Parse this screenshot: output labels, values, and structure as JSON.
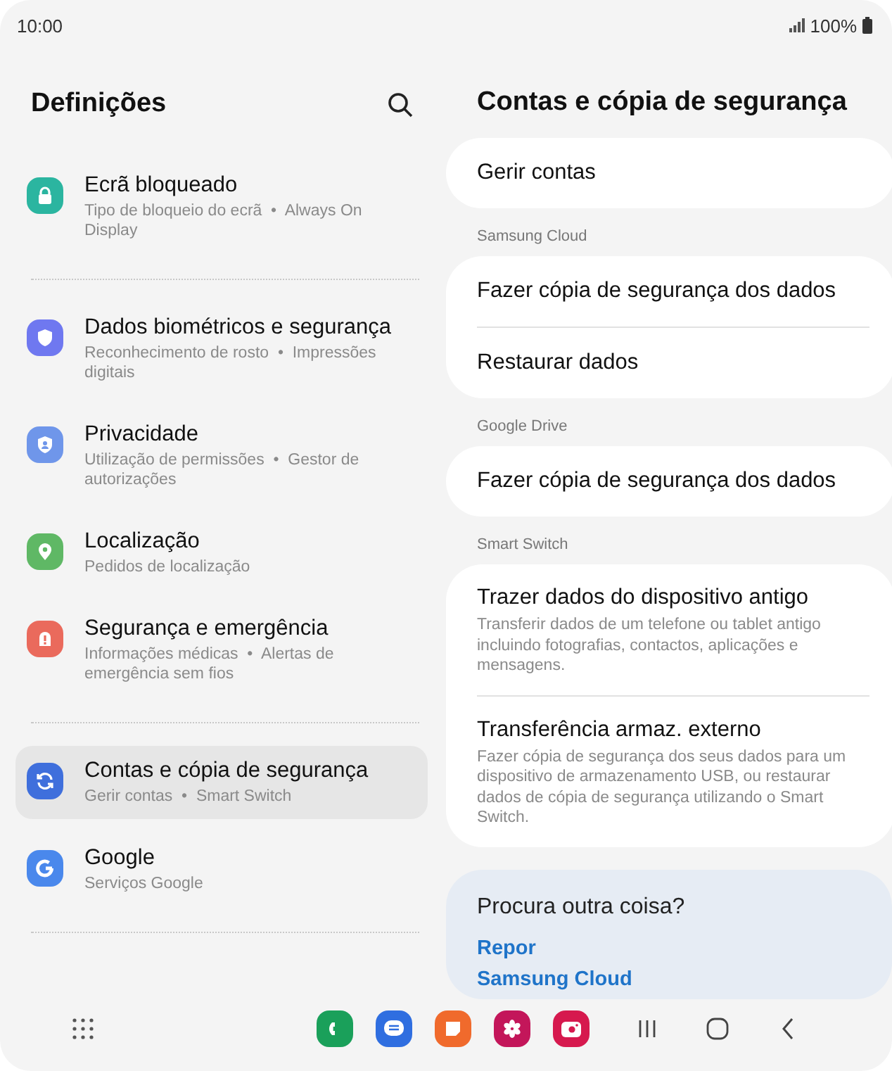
{
  "status_bar": {
    "time": "10:00",
    "battery": "100%"
  },
  "settings": {
    "title": "Definições",
    "groups": [
      {
        "items": [
          {
            "kind": "lock",
            "color": "#2bb5a0",
            "title": "Ecrã bloqueado",
            "subtitle": "Tipo de bloqueio do ecrã  •  Always On Display",
            "selected": false
          }
        ]
      },
      {
        "items": [
          {
            "kind": "shield",
            "color": "#6f78f0",
            "title": "Dados biométricos e segurança",
            "subtitle": "Reconhecimento de rosto  •  Impressões digitais",
            "selected": false
          },
          {
            "kind": "privacy",
            "color": "#6f96ea",
            "title": "Privacidade",
            "subtitle": "Utilização de permissões  •  Gestor de autorizações",
            "selected": false
          },
          {
            "kind": "location",
            "color": "#5fb865",
            "title": "Localização",
            "subtitle": "Pedidos de localização",
            "selected": false
          },
          {
            "kind": "alert",
            "color": "#ea6a5c",
            "title": "Segurança e emergência",
            "subtitle": "Informações médicas  •  Alertas de emergência sem fios",
            "selected": false
          }
        ]
      },
      {
        "items": [
          {
            "kind": "sync",
            "color": "#3f6fdc",
            "title": "Contas e cópia de segurança",
            "subtitle": "Gerir contas  •  Smart Switch",
            "selected": true
          },
          {
            "kind": "google",
            "color": "#4a88ec",
            "title": "Google",
            "subtitle": "Serviços Google",
            "selected": false
          }
        ]
      }
    ]
  },
  "detail": {
    "title": "Contas e cópia de segurança",
    "sections": [
      {
        "items": [
          {
            "title": "Gerir contas"
          }
        ]
      },
      {
        "header": "Samsung Cloud",
        "items": [
          {
            "title": "Fazer cópia de segurança dos dados"
          },
          {
            "title": "Restaurar dados"
          }
        ]
      },
      {
        "header": "Google Drive",
        "items": [
          {
            "title": "Fazer cópia de segurança dos dados"
          }
        ]
      },
      {
        "header": "Smart Switch",
        "items": [
          {
            "title": "Trazer dados do dispositivo antigo",
            "subtitle": "Transferir dados de um telefone ou tablet antigo incluindo fotografias, contactos, aplicações e mensagens."
          },
          {
            "title": "Transferência armaz. externo",
            "subtitle": "Fazer cópia de segurança dos seus dados para um dispositivo de armazenamento USB, ou restaurar dados de cópia de segurança utilizando o Smart Switch."
          }
        ]
      }
    ],
    "suggestions": {
      "title": "Procura outra coisa?",
      "links": [
        "Repor",
        "Samsung Cloud"
      ]
    }
  },
  "dock": {
    "apps": [
      {
        "kind": "phone",
        "color": "#1aa05a"
      },
      {
        "kind": "messages",
        "color": "#2f6ee0"
      },
      {
        "kind": "notes",
        "color": "#f06a2c"
      },
      {
        "kind": "flower",
        "color": "#c3165a"
      },
      {
        "kind": "camera",
        "color": "#d6194e"
      }
    ]
  }
}
